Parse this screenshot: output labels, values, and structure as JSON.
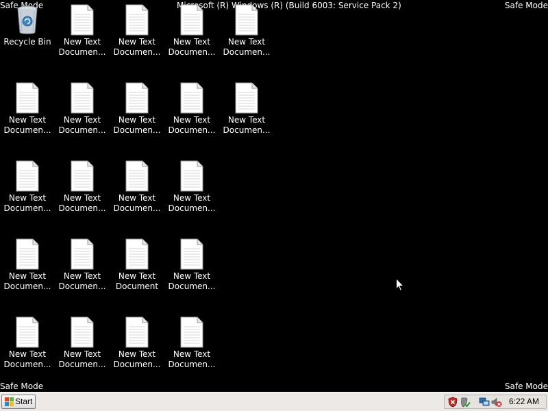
{
  "watermarks": {
    "top_left": "Safe Mode",
    "top_right": "Safe Mode",
    "bottom_left": "Safe Mode",
    "bottom_right": "Safe Mode",
    "build": "Microsoft (R) Windows (R) (Build 6003: Service Pack 2)"
  },
  "desktop_icons": [
    {
      "label": "Recycle Bin",
      "icon": "recycle-bin-icon"
    },
    {
      "label": "New Text Documen...",
      "icon": "text-document-icon"
    },
    {
      "label": "New Text Documen...",
      "icon": "text-document-icon"
    },
    {
      "label": "New Text Documen...",
      "icon": "text-document-icon"
    },
    {
      "label": "New Text Documen...",
      "icon": "text-document-icon"
    },
    {
      "label": "New Text Documen...",
      "icon": "text-document-icon"
    },
    {
      "label": "New Text Documen...",
      "icon": "text-document-icon"
    },
    {
      "label": "New Text Documen...",
      "icon": "text-document-icon"
    },
    {
      "label": "New Text Documen...",
      "icon": "text-document-icon"
    },
    {
      "label": "New Text Documen...",
      "icon": "text-document-icon"
    },
    {
      "label": "New Text Documen...",
      "icon": "text-document-icon"
    },
    {
      "label": "New Text Documen...",
      "icon": "text-document-icon"
    },
    {
      "label": "New Text Documen...",
      "icon": "text-document-icon"
    },
    {
      "label": "New Text Document",
      "icon": "text-document-icon"
    },
    {
      "label": "New Text Documen...",
      "icon": "text-document-icon"
    },
    {
      "label": "New Text Documen...",
      "icon": "text-document-icon"
    },
    {
      "label": "New Text Documen...",
      "icon": "text-document-icon"
    },
    {
      "label": "New Text Documen...",
      "icon": "text-document-icon"
    },
    {
      "label": "New Text Documen...",
      "icon": "text-document-icon"
    },
    {
      "label": "New Text Documen...",
      "icon": "text-document-icon"
    },
    {
      "label": "New Text Documen...",
      "icon": "text-document-icon"
    },
    {
      "label": "New Text Documen...",
      "icon": "text-document-icon"
    }
  ],
  "taskbar": {
    "start_label": "Start",
    "tray_icons": [
      "security-alert-icon",
      "security-shield-icon",
      "network-icon",
      "volume-muted-icon"
    ],
    "clock": "6:22 AM"
  },
  "colors": {
    "desktop_background": "#000000",
    "taskbar_background": "#ece9e6",
    "watermark_text": "#ffffff"
  }
}
